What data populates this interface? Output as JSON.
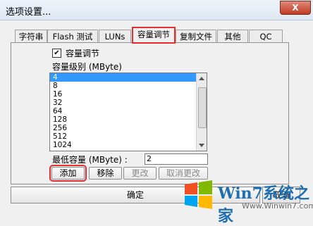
{
  "window": {
    "title": "选项设置...",
    "close_label": "X"
  },
  "tabs": [
    {
      "label": "字符串"
    },
    {
      "label": "Flash 测试"
    },
    {
      "label": "LUNs"
    },
    {
      "label": "容量调节"
    },
    {
      "label": "复制文件"
    },
    {
      "label": "其他"
    },
    {
      "label": "QC"
    }
  ],
  "capacity": {
    "enable_checkbox_label": "容量调节",
    "checked_mark": "✔",
    "level_label": "容量级别 (MByte)",
    "levels": [
      "4",
      "8",
      "16",
      "32",
      "64",
      "128",
      "256",
      "512",
      "1024"
    ],
    "min_label": "最低容量 (MByte) :",
    "min_value": "2"
  },
  "buttons": {
    "add": "添加",
    "remove": "移除",
    "change": "更改",
    "cancel_change": "取消更改"
  },
  "footer": {
    "ok": "确定",
    "cancel": "取消"
  },
  "watermark": {
    "text": "Win7系统之家",
    "url": "Www.Winwin7.com"
  }
}
